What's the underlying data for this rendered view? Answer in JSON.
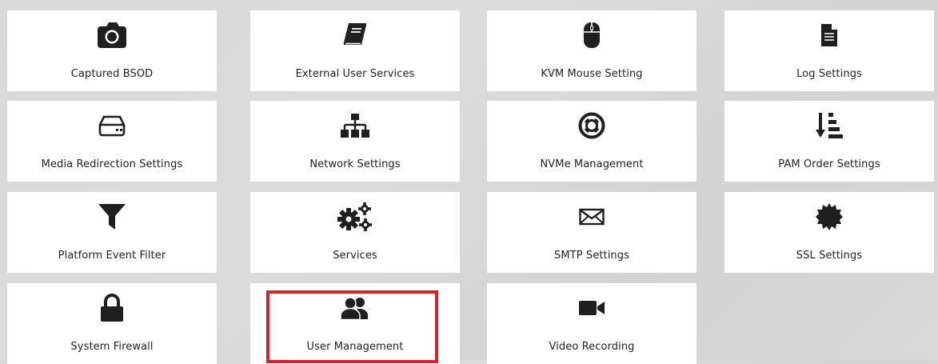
{
  "tiles": [
    {
      "label": "Captured BSOD",
      "icon": "camera-icon"
    },
    {
      "label": "External User Services",
      "icon": "book-icon"
    },
    {
      "label": "KVM Mouse Setting",
      "icon": "mouse-icon"
    },
    {
      "label": "Log Settings",
      "icon": "file-text-icon"
    },
    {
      "label": "Media Redirection Settings",
      "icon": "hard-drive-icon"
    },
    {
      "label": "Network Settings",
      "icon": "sitemap-icon"
    },
    {
      "label": "NVMe Management",
      "icon": "life-ring-icon"
    },
    {
      "label": "PAM Order Settings",
      "icon": "sort-amount-down-icon"
    },
    {
      "label": "Platform Event Filter",
      "icon": "filter-icon"
    },
    {
      "label": "Services",
      "icon": "cogs-icon"
    },
    {
      "label": "SMTP Settings",
      "icon": "envelope-icon"
    },
    {
      "label": "SSL Settings",
      "icon": "certificate-icon"
    },
    {
      "label": "System Firewall",
      "icon": "lock-icon"
    },
    {
      "label": "User Management",
      "icon": "users-icon"
    },
    {
      "label": "Video Recording",
      "icon": "video-camera-icon"
    }
  ],
  "highlight": {
    "tile": "User Management",
    "color": "#d9202a"
  },
  "colors": {
    "tile_bg": "#ffffff",
    "icon": "#1f1f1f",
    "page_bg": "#d9d9d9"
  }
}
